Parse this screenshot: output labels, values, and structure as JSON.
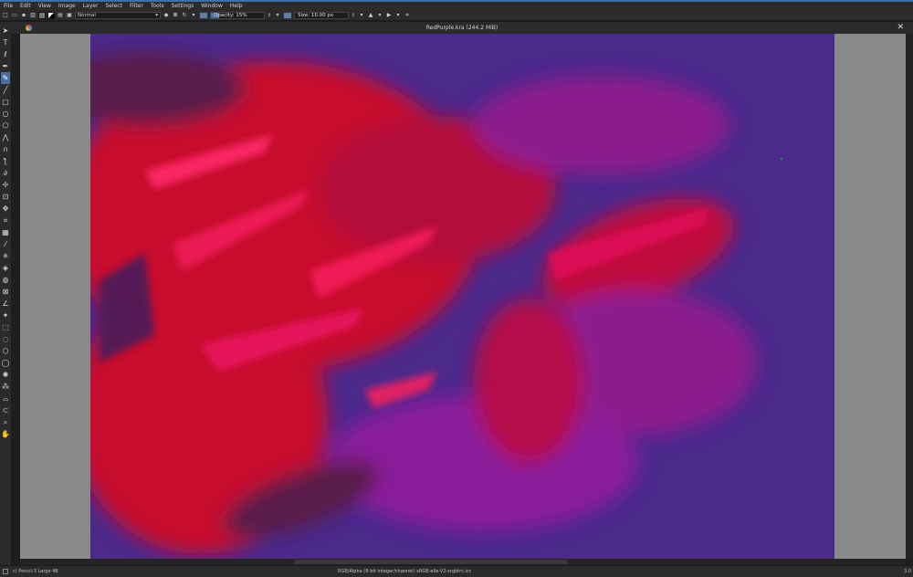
{
  "menu": {
    "items": [
      "File",
      "Edit",
      "View",
      "Image",
      "Layer",
      "Select",
      "Filter",
      "Tools",
      "Settings",
      "Window",
      "Help"
    ]
  },
  "toolbar": {
    "blend_mode": "Normal",
    "opacity_label": "Opacity: 15%",
    "opacity_value": 15,
    "size_label": "Size: 10.00 px",
    "accent_color": "#4a6fa5"
  },
  "document": {
    "title": "RedPurple.kra (244.2 MiB)",
    "close_glyph": "✕"
  },
  "canvas": {
    "background_color": "#4b2a8c",
    "brush_colors": [
      "#d4002a",
      "#e8155a",
      "#9a1a8c",
      "#5a1a4a"
    ]
  },
  "status": {
    "left": "c) Pencil-3 Large 4B",
    "center": "RGB/Alpha (8-bit integer/channel)  sRGB-elle-V2-srgbtrc.icc",
    "right": "3.0"
  },
  "icons": {
    "tools": [
      "pointer-icon",
      "text-icon",
      "calligraphy-icon",
      "pen-icon",
      "brush-icon",
      "line-icon",
      "rectangle-icon",
      "ellipse-icon",
      "polygon-icon",
      "polyline-icon",
      "bezier-icon",
      "freehand-path-icon",
      "dynamic-brush-icon",
      "multibrush-icon",
      "transform-icon",
      "move-icon",
      "crop-icon",
      "gradient-icon",
      "color-picker-icon",
      "smart-patch-icon",
      "fill-icon",
      "enclose-fill-icon",
      "assistant-icon",
      "measure-icon",
      "reference-icon",
      "rect-select-icon",
      "ellipse-select-icon",
      "polygon-select-icon",
      "freehand-select-icon",
      "contiguous-select-icon",
      "similar-select-icon",
      "bezier-select-icon",
      "magnetic-select-icon",
      "zoom-icon",
      "pan-icon"
    ]
  }
}
